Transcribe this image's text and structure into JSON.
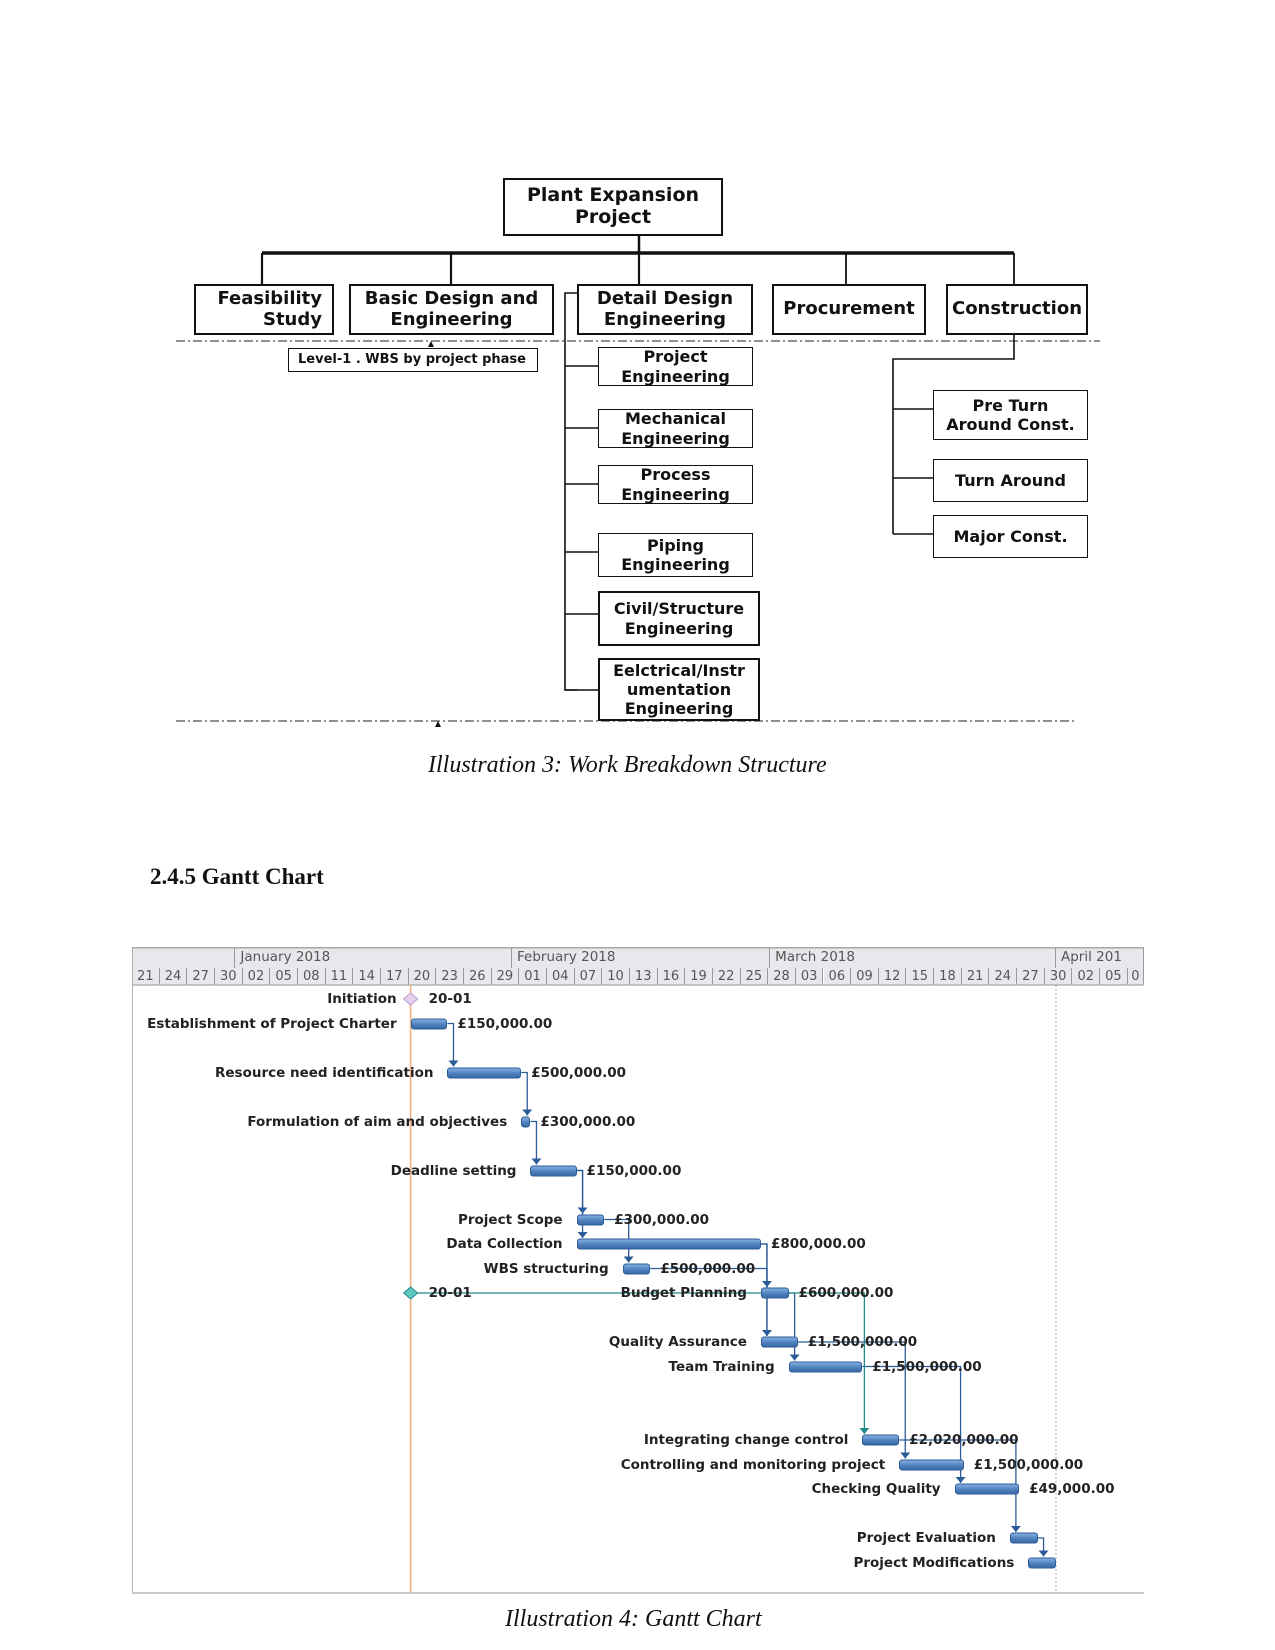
{
  "wbs": {
    "root": "Plant Expansion\nProject",
    "level1": [
      {
        "label": "Feasibility\nStudy"
      },
      {
        "label": "Basic Design and\nEngineering"
      },
      {
        "label": "Detail Design\nEngineering"
      },
      {
        "label": "Procurement"
      },
      {
        "label": "Construction"
      }
    ],
    "detail_design_children": [
      {
        "label": "Project\nEngineering"
      },
      {
        "label": "Mechanical\nEngineering"
      },
      {
        "label": "Process\nEngineering"
      },
      {
        "label": "Piping\nEngineering"
      },
      {
        "label": "Civil/Structure\nEngineering"
      },
      {
        "label": "Eelctrical/Instr\numentation\nEngineering"
      }
    ],
    "construction_children": [
      {
        "label": "Pre Turn\nAround Const."
      },
      {
        "label": "Turn Around"
      },
      {
        "label": "Major Const."
      }
    ],
    "level_note": "Level-1 . WBS by project phase",
    "caption": "Illustration 3: Work Breakdown Structure"
  },
  "section_heading": "2.4.5 Gantt Chart",
  "gantt_caption": "Illustration 4: Gantt Chart",
  "chart_data": {
    "type": "gantt",
    "title": "",
    "timeline_start": "2017-12-21",
    "timeline_end": "2018-04-07",
    "months": [
      {
        "label": "",
        "start": "2017-12-21"
      },
      {
        "label": "January 2018",
        "start": "2018-01-01"
      },
      {
        "label": "February 2018",
        "start": "2018-01-31"
      },
      {
        "label": "March 2018",
        "start": "2018-02-28"
      },
      {
        "label": "April 201",
        "start": "2018-03-31"
      }
    ],
    "day_ticks": [
      "21",
      "24",
      "27",
      "30",
      "02",
      "05",
      "08",
      "11",
      "14",
      "17",
      "20",
      "23",
      "26",
      "29",
      "01",
      "04",
      "07",
      "10",
      "13",
      "16",
      "19",
      "22",
      "25",
      "28",
      "03",
      "06",
      "09",
      "12",
      "15",
      "18",
      "21",
      "24",
      "27",
      "30",
      "02",
      "05",
      "0"
    ],
    "current_date_line": "2018-01-20",
    "deadline_line": "2018-03-31",
    "milestones": [
      {
        "name": "Initiation",
        "date": "2018-01-20",
        "label": "20-01",
        "row": 0
      },
      {
        "name": "",
        "date": "2018-01-20",
        "label": "20-01",
        "row": 12,
        "links_to": "Integrating change control"
      }
    ],
    "tasks": [
      {
        "name": "Establishment of Project Charter",
        "start": "2018-01-20",
        "end": "2018-01-24",
        "cost": "£150,000.00",
        "row": 1
      },
      {
        "name": "Resource need identification",
        "start": "2018-01-24",
        "end": "2018-02-01",
        "cost": "£500,000.00",
        "row": 3
      },
      {
        "name": "Formulation of aim and objectives",
        "start": "2018-02-01",
        "end": "2018-02-02",
        "cost": "£300,000.00",
        "row": 5
      },
      {
        "name": "Deadline setting",
        "start": "2018-02-02",
        "end": "2018-02-07",
        "cost": "£150,000.00",
        "row": 7
      },
      {
        "name": "Project Scope",
        "start": "2018-02-07",
        "end": "2018-02-10",
        "cost": "£300,000.00",
        "row": 9
      },
      {
        "name": "Data Collection",
        "start": "2018-02-07",
        "end": "2018-02-27",
        "cost": "£800,000.00",
        "row": 10
      },
      {
        "name": "WBS structuring",
        "start": "2018-02-12",
        "end": "2018-02-15",
        "cost": "£500,000.00",
        "row": 11
      },
      {
        "name": "Budget Planning",
        "start": "2018-02-27",
        "end": "2018-03-02",
        "cost": "£600,000.00",
        "row": 12
      },
      {
        "name": "Quality Assurance",
        "start": "2018-02-27",
        "end": "2018-03-03",
        "cost": "£1,500,000.00",
        "row": 14
      },
      {
        "name": "Team Training",
        "start": "2018-03-02",
        "end": "2018-03-10",
        "cost": "£1,500,000.00",
        "row": 15
      },
      {
        "name": "Integrating change control",
        "start": "2018-03-10",
        "end": "2018-03-14",
        "cost": "£2,020,000.00",
        "row": 18
      },
      {
        "name": "Controlling and monitoring project",
        "start": "2018-03-14",
        "end": "2018-03-21",
        "cost": "£1,500,000.00",
        "row": 19
      },
      {
        "name": "Checking Quality",
        "start": "2018-03-20",
        "end": "2018-03-27",
        "cost": "£49,000.00",
        "row": 20
      },
      {
        "name": "Project Evaluation",
        "start": "2018-03-26",
        "end": "2018-03-29",
        "cost": "",
        "row": 22
      },
      {
        "name": "Project Modifications",
        "start": "2018-03-28",
        "end": "2018-03-31",
        "cost": "",
        "row": 23
      }
    ],
    "dependencies": [
      [
        "Establishment of Project Charter",
        "Resource need identification"
      ],
      [
        "Resource need identification",
        "Formulation of aim and objectives"
      ],
      [
        "Formulation of aim and objectives",
        "Deadline setting"
      ],
      [
        "Deadline setting",
        "Project Scope"
      ],
      [
        "Deadline setting",
        "Data Collection"
      ],
      [
        "Project Scope",
        "WBS structuring"
      ],
      [
        "Data Collection",
        "Budget Planning"
      ],
      [
        "WBS structuring",
        "Quality Assurance"
      ],
      [
        "Data Collection",
        "Quality Assurance"
      ],
      [
        "Budget Planning",
        "Team Training"
      ],
      [
        "Quality Assurance",
        "Controlling and monitoring project"
      ],
      [
        "Team Training",
        "Checking Quality"
      ],
      [
        "Integrating change control",
        "Project Evaluation"
      ],
      [
        "Project Evaluation",
        "Project Modifications"
      ]
    ],
    "colors": {
      "bar_fill": "#4f81bd",
      "bar_border": "#2c5c97",
      "link": "#2c5c97",
      "milestone_link": "#1f8a8a",
      "today_line": "#f4b183",
      "header_bg": "#e6e8ec"
    }
  }
}
